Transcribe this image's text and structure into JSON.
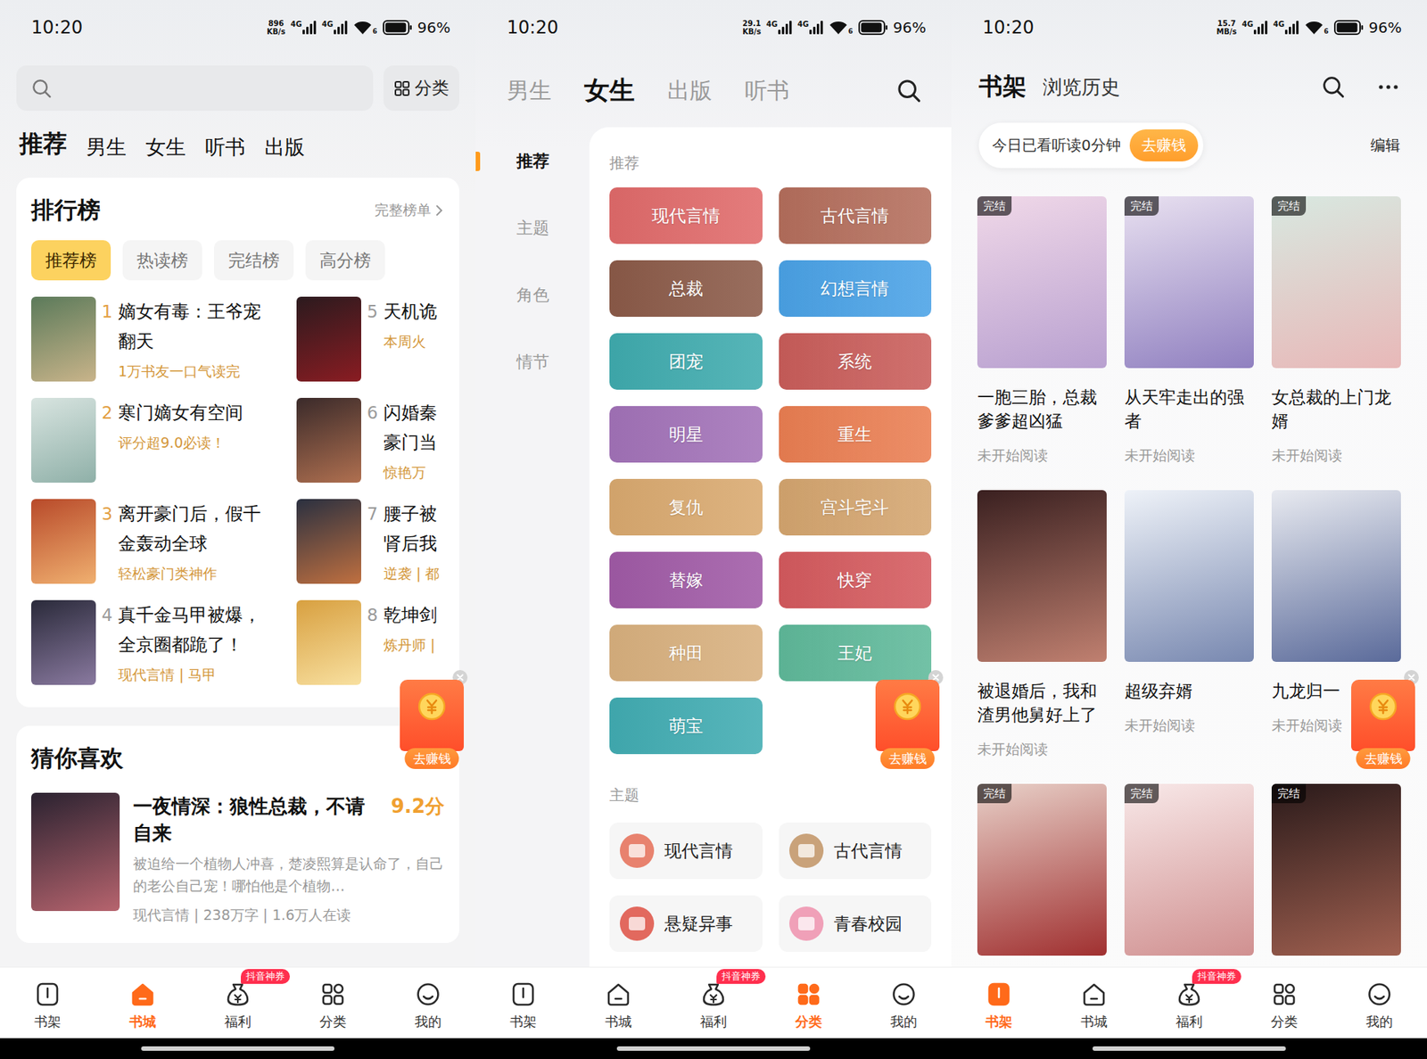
{
  "bookstore": {
    "status_bar": {
      "time": "10:20",
      "speed": "896",
      "speed_unit": "KB/s",
      "network": [
        "4G",
        "4G"
      ],
      "wifi_label": "6",
      "battery": "96%",
      "battery_level": 0.96
    },
    "category_button": "分类",
    "tabs": [
      {
        "label": "推荐",
        "selected": true
      },
      {
        "label": "男生",
        "selected": false
      },
      {
        "label": "女生",
        "selected": false
      },
      {
        "label": "听书",
        "selected": false
      },
      {
        "label": "出版",
        "selected": false
      }
    ],
    "ranking": {
      "title": "排行榜",
      "more": "完整榜单",
      "chips": [
        {
          "label": "推荐榜",
          "selected": true
        },
        {
          "label": "热读榜",
          "selected": false
        },
        {
          "label": "完结榜",
          "selected": false
        },
        {
          "label": "高分榜",
          "selected": false
        }
      ],
      "items": [
        {
          "rank": "1",
          "title": "嫡女有毒：王爷宠翻天",
          "subtitle": "1万书友一口气读完",
          "top": true
        },
        {
          "rank": "2",
          "title": "寒门嫡女有空间",
          "subtitle": "评分超9.0必读！",
          "top": true
        },
        {
          "rank": "3",
          "title": "离开豪门后，假千金轰动全球",
          "subtitle": "轻松豪门类神作",
          "top": true
        },
        {
          "rank": "4",
          "title": "真千金马甲被爆，全京圈都跪了！",
          "subtitle": "现代言情 | 马甲",
          "top": false
        },
        {
          "rank": "5",
          "title": "天机诡",
          "subtitle": "本周火",
          "top": false
        },
        {
          "rank": "6",
          "title": "闪婚秦豪门当",
          "subtitle": "惊艳万",
          "top": false
        },
        {
          "rank": "7",
          "title": "腰子被肾后我",
          "subtitle": "逆袭 | 都",
          "top": false
        },
        {
          "rank": "8",
          "title": "乾坤剑",
          "subtitle": "炼丹师 |",
          "top": false
        }
      ]
    },
    "guess": {
      "title": "猜你喜欢",
      "book": {
        "title": "一夜情深：狼性总裁，不请自来",
        "score": "9.2分",
        "description": "被迫给一个植物人冲喜，楚凌熙算是认命了，自己的老公自己宠！哪怕他是个植物…",
        "meta": "现代言情 | 238万字 | 1.6万人在读"
      }
    },
    "float_widget": {
      "label": "去赚钱"
    },
    "nav": [
      {
        "label": "书架",
        "selected": false
      },
      {
        "label": "书城",
        "selected": true
      },
      {
        "label": "福利",
        "selected": false,
        "badge": "抖音神券"
      },
      {
        "label": "分类",
        "selected": false
      },
      {
        "label": "我的",
        "selected": false
      }
    ]
  },
  "category": {
    "status_bar": {
      "time": "10:20",
      "speed": "29.1",
      "speed_unit": "KB/s",
      "network": [
        "4G",
        "4G"
      ],
      "wifi_label": "6",
      "battery": "96%",
      "battery_level": 0.96
    },
    "top_tabs": [
      {
        "label": "男生",
        "selected": false
      },
      {
        "label": "女生",
        "selected": true
      },
      {
        "label": "出版",
        "selected": false
      },
      {
        "label": "听书",
        "selected": false
      }
    ],
    "sidebar": [
      {
        "label": "推荐",
        "selected": true
      },
      {
        "label": "主题",
        "selected": false
      },
      {
        "label": "角色",
        "selected": false
      },
      {
        "label": "情节",
        "selected": false
      }
    ],
    "sections": [
      {
        "title": "推荐",
        "kind": "tile",
        "items": [
          {
            "label": "现代言情",
            "color": "#e06a6a"
          },
          {
            "label": "古代言情",
            "color": "#b46e5c"
          },
          {
            "label": "总裁",
            "color": "#8b5a48"
          },
          {
            "label": "幻想言情",
            "color": "#4aa2e6"
          },
          {
            "label": "团宠",
            "color": "#3fabae"
          },
          {
            "label": "系统",
            "color": "#c95d5a"
          },
          {
            "label": "明星",
            "color": "#a272b8"
          },
          {
            "label": "重生",
            "color": "#ea7e52"
          },
          {
            "label": "复仇",
            "color": "#d9a96f"
          },
          {
            "label": "宫斗宅斗",
            "color": "#d4a56f"
          },
          {
            "label": "替嫁",
            "color": "#a05aa6"
          },
          {
            "label": "快穿",
            "color": "#d45a5e"
          },
          {
            "label": "种田",
            "color": "#d8b07e"
          },
          {
            "label": "王妃",
            "color": "#5fb99a"
          },
          {
            "label": "萌宝",
            "color": "#41acb2"
          }
        ]
      },
      {
        "title": "主题",
        "kind": "chip",
        "items": [
          {
            "label": "现代言情",
            "color": "#e8826e"
          },
          {
            "label": "古代言情",
            "color": "#c9a27a"
          },
          {
            "label": "悬疑异事",
            "color": "#e2695e"
          },
          {
            "label": "青春校园",
            "color": "#f0a0b8"
          }
        ]
      }
    ],
    "float_widget": {
      "label": "去赚钱"
    },
    "nav": [
      {
        "label": "书架",
        "selected": false
      },
      {
        "label": "书城",
        "selected": false
      },
      {
        "label": "福利",
        "selected": false,
        "badge": "抖音神券"
      },
      {
        "label": "分类",
        "selected": true
      },
      {
        "label": "我的",
        "selected": false
      }
    ]
  },
  "bookshelf": {
    "status_bar": {
      "time": "10:20",
      "speed": "15.7",
      "speed_unit": "MB/s",
      "network": [
        "4G",
        "4G"
      ],
      "wifi_label": "6",
      "battery": "96%",
      "battery_level": 0.96
    },
    "tabs": [
      {
        "label": "书架",
        "selected": true
      },
      {
        "label": "浏览历史",
        "selected": false
      }
    ],
    "reading_pill": {
      "text": "今日已看听读0分钟",
      "button": "去赚钱"
    },
    "edit": "编辑",
    "finished_label": "完结",
    "books": [
      {
        "title": "一胞三胎，总裁爹爹超凶猛",
        "status": "未开始阅读",
        "finished": true
      },
      {
        "title": "从天牢走出的强者",
        "status": "未开始阅读",
        "finished": true
      },
      {
        "title": "女总裁的上门龙婿",
        "status": "未开始阅读",
        "finished": true
      },
      {
        "title": "被退婚后，我和渣男他舅好上了",
        "status": "未开始阅读",
        "finished": false
      },
      {
        "title": "超级弃婿",
        "status": "未开始阅读",
        "finished": false
      },
      {
        "title": "九龙归一",
        "status": "未开始阅读",
        "finished": false
      }
    ],
    "more_books": [
      {
        "finished": true
      },
      {
        "finished": true
      },
      {
        "finished": true
      }
    ],
    "float_widget": {
      "label": "去赚钱"
    },
    "nav": [
      {
        "label": "书架",
        "selected": true
      },
      {
        "label": "书城",
        "selected": false
      },
      {
        "label": "福利",
        "selected": false,
        "badge": "抖音神券"
      },
      {
        "label": "分类",
        "selected": false
      },
      {
        "label": "我的",
        "selected": false
      }
    ]
  }
}
